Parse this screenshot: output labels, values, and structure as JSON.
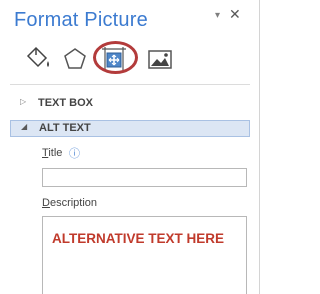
{
  "pane": {
    "title": "Format Picture",
    "dropdown_glyph": "▾",
    "close_glyph": "✕",
    "tabs": [
      {
        "name": "fill-line",
        "icon": "paint-bucket-icon"
      },
      {
        "name": "effects",
        "icon": "pentagon-icon"
      },
      {
        "name": "size-properties",
        "icon": "size-properties-icon",
        "selected": true
      },
      {
        "name": "picture",
        "icon": "picture-icon"
      }
    ],
    "highlight_color": "#b33b3b"
  },
  "sections": {
    "text_box": {
      "label": "TEXT BOX",
      "arrow": "▷",
      "expanded": false
    },
    "alt_text": {
      "label": "ALT TEXT",
      "arrow": "◢",
      "expanded": true
    }
  },
  "fields": {
    "title": {
      "mnemonic": "T",
      "rest": "itle",
      "info_glyph": "ⓘ",
      "value": ""
    },
    "description": {
      "mnemonic": "D",
      "rest": "escription",
      "value": "ALTERNATIVE TEXT HERE"
    }
  },
  "colors": {
    "title_blue": "#3c7bd0",
    "section_highlight": "#dce6f4",
    "description_text": "#c03a2b"
  }
}
